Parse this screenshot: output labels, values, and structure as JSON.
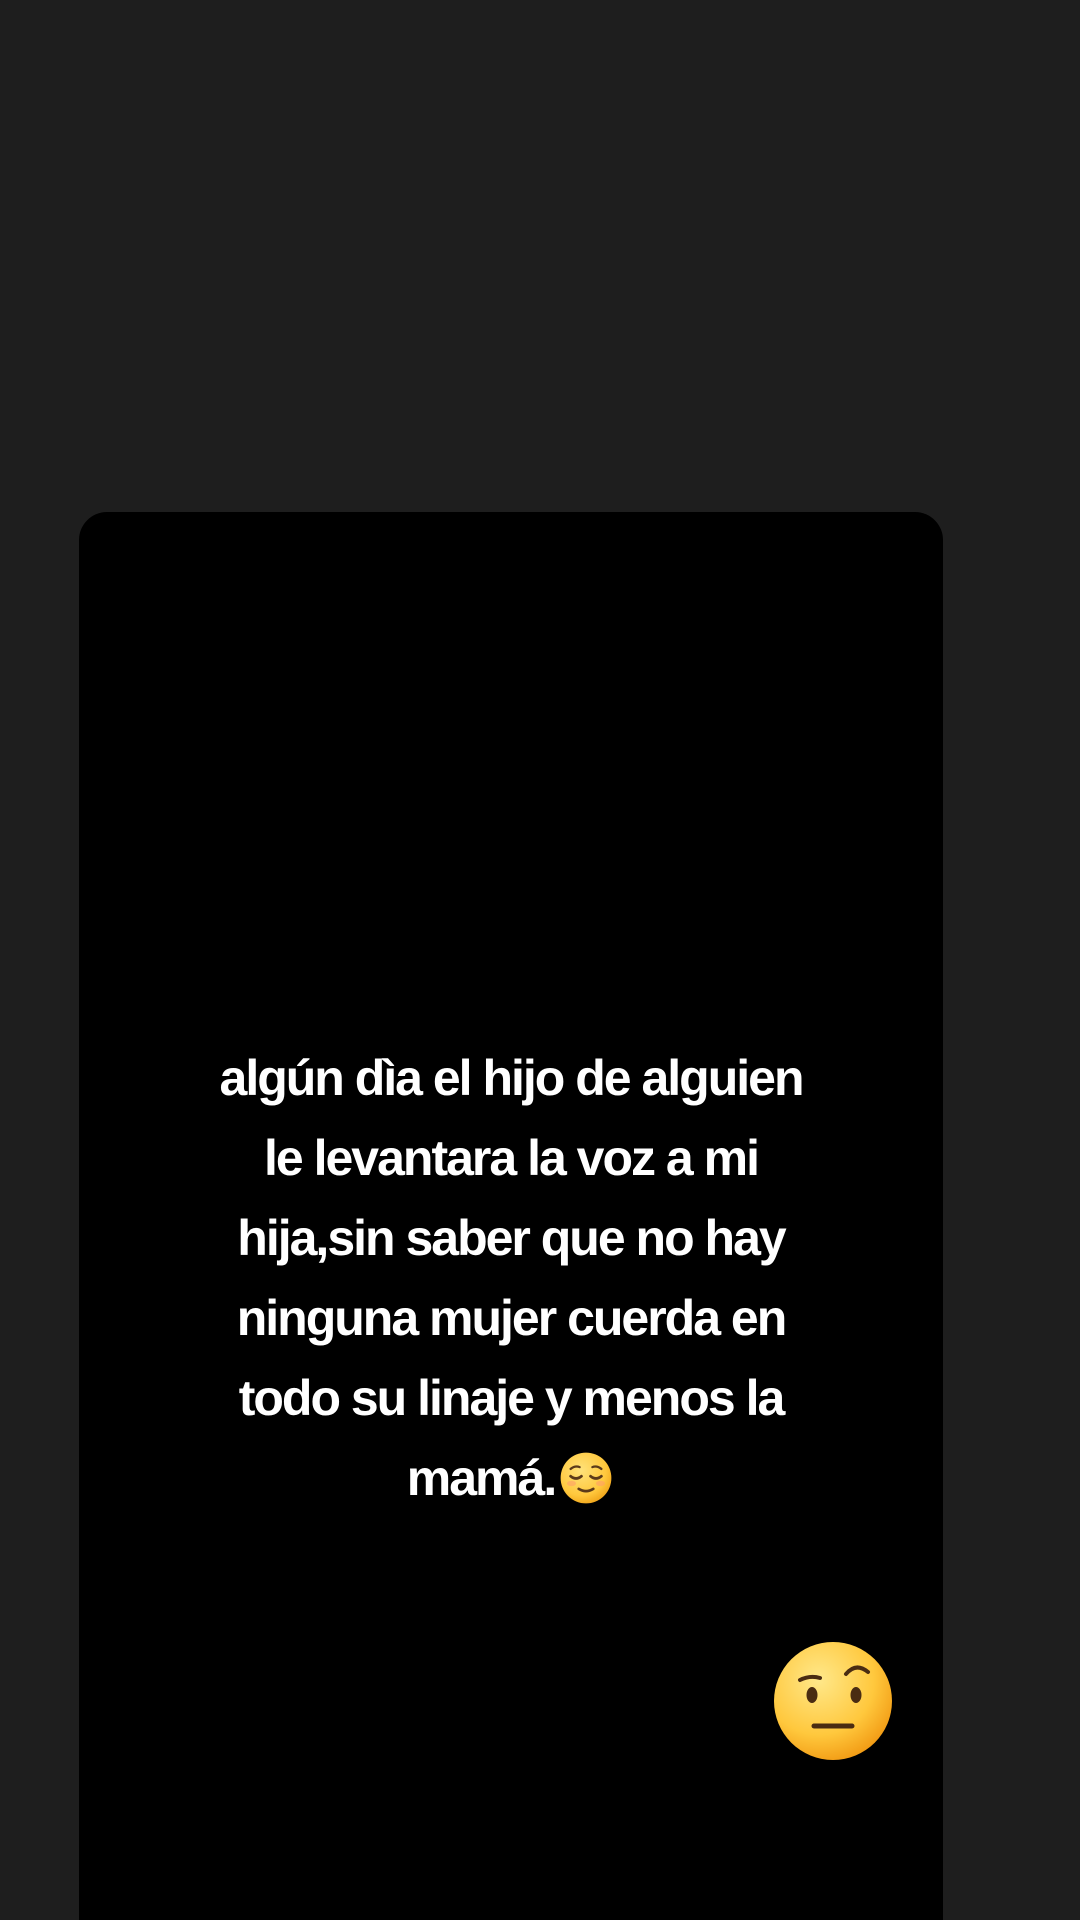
{
  "post": {
    "caption_lines": [
      "algún dìa el hijo de alguien",
      "le levantara la voz a mi",
      "hija,sin saber que no hay",
      "ninguna mujer cuerda en",
      "todo su linaje y menos la",
      "mamá."
    ],
    "caption_emoji": "relieved-face-icon",
    "sticker_emoji": "face-with-raised-eyebrow-icon"
  },
  "colors": {
    "page_background": "#1e1e1e",
    "card_background": "#000000",
    "caption_text": "#ffffff",
    "caption_outline": "#000000",
    "emoji_yellow": "#ffc83d"
  }
}
